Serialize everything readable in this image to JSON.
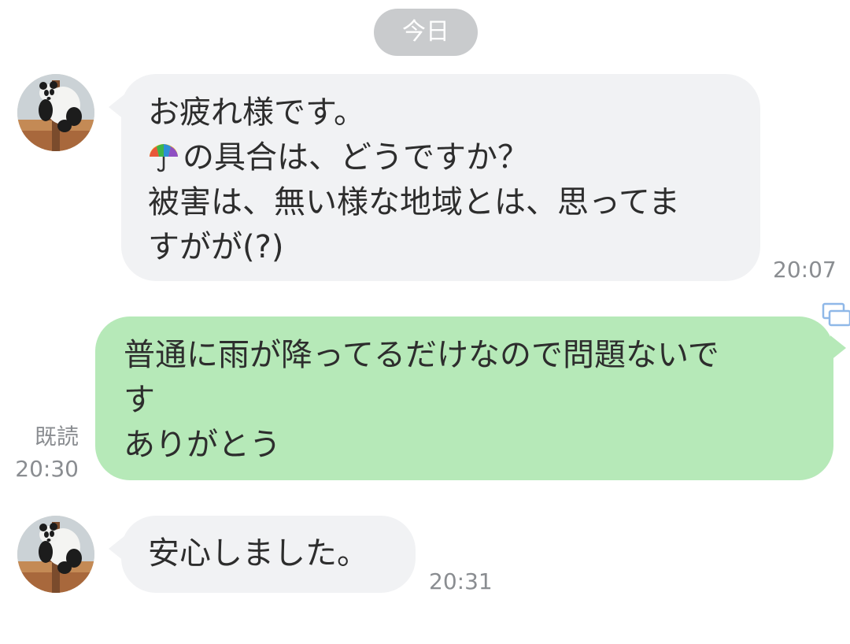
{
  "date_separator": "今日",
  "messages": [
    {
      "sender": "other",
      "lines": [
        "お疲れ様です。",
        "の具合は、どうですか？",
        "被害は、無い様な地域とは、思ってま",
        "すがが(?)"
      ],
      "emoji": "umbrella-icon",
      "time": "20:07"
    },
    {
      "sender": "me",
      "lines": [
        "普通に雨が降ってるだけなので問題ないで",
        "す",
        "ありがとう"
      ],
      "read_label": "既読",
      "time": "20:30"
    },
    {
      "sender": "other",
      "lines": [
        "安心しました。"
      ],
      "time": "20:31"
    }
  ],
  "colors": {
    "incoming_bubble": "#f1f2f4",
    "outgoing_bubble": "#b6e9b8",
    "date_pill": "#c9cbcd",
    "meta_text": "#8a8d91"
  }
}
